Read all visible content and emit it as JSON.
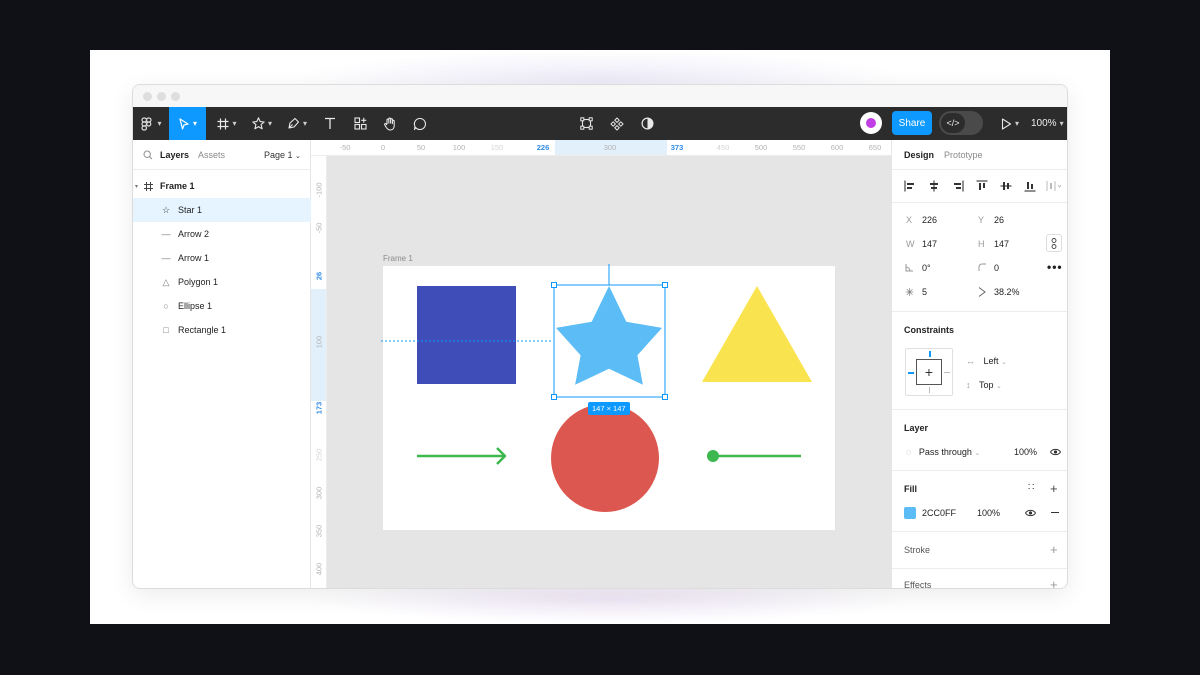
{
  "toolbar": {
    "share_label": "Share",
    "dev_mode_label": "</>",
    "zoom_label": "100%"
  },
  "left_panel": {
    "tabs": [
      {
        "label": "Layers",
        "active": true
      },
      {
        "label": "Assets",
        "active": false
      }
    ],
    "page_label": "Page 1",
    "layers": [
      {
        "label": "Frame 1",
        "icon": "frame-icon",
        "selected": false
      },
      {
        "label": "Star 1",
        "icon": "star-icon",
        "selected": true
      },
      {
        "label": "Arrow 2",
        "icon": "line-icon",
        "selected": false
      },
      {
        "label": "Arrow 1",
        "icon": "line-icon",
        "selected": false
      },
      {
        "label": "Polygon 1",
        "icon": "polygon-icon",
        "selected": false
      },
      {
        "label": "Ellipse 1",
        "icon": "ellipse-icon",
        "selected": false
      },
      {
        "label": "Rectangle 1",
        "icon": "rectangle-icon",
        "selected": false
      }
    ]
  },
  "rulers": {
    "horizontal": [
      "-50",
      "0",
      "50",
      "100",
      "150",
      "226",
      "300",
      "373",
      "450",
      "500",
      "550",
      "600",
      "650"
    ],
    "horizontal_highlight": [
      "226",
      "373"
    ],
    "vertical": [
      "-100",
      "-50",
      "26",
      "100",
      "173",
      "250",
      "300",
      "350",
      "400"
    ],
    "vertical_highlight": [
      "26",
      "173"
    ]
  },
  "canvas": {
    "frame_label": "Frame 1",
    "selection_size": "147 × 147",
    "colors": {
      "rectangle": "#3f4db8",
      "star": "#5cbcf6",
      "triangle": "#f9e44f",
      "ellipse": "#dc574f",
      "arrows": "#3cb84f",
      "selection": "#0d99ff"
    }
  },
  "right_panel": {
    "tabs": [
      {
        "label": "Design",
        "active": true
      },
      {
        "label": "Prototype",
        "active": false
      }
    ],
    "x_label": "X",
    "x_value": "226",
    "y_label": "Y",
    "y_value": "26",
    "w_label": "W",
    "w_value": "147",
    "h_label": "H",
    "h_value": "147",
    "rotation_value": "0°",
    "radius_value": "0",
    "points_value": "5",
    "ratio_value": "38.2%",
    "constraints_title": "Constraints",
    "constraint_h": "Left",
    "constraint_v": "Top",
    "layer_title": "Layer",
    "blend_mode": "Pass through",
    "layer_opacity": "100%",
    "fill_title": "Fill",
    "fill_hex": "2CC0FF",
    "fill_opacity": "100%",
    "fill_color": "#5cbcf6",
    "stroke_title": "Stroke",
    "effects_title": "Effects"
  }
}
